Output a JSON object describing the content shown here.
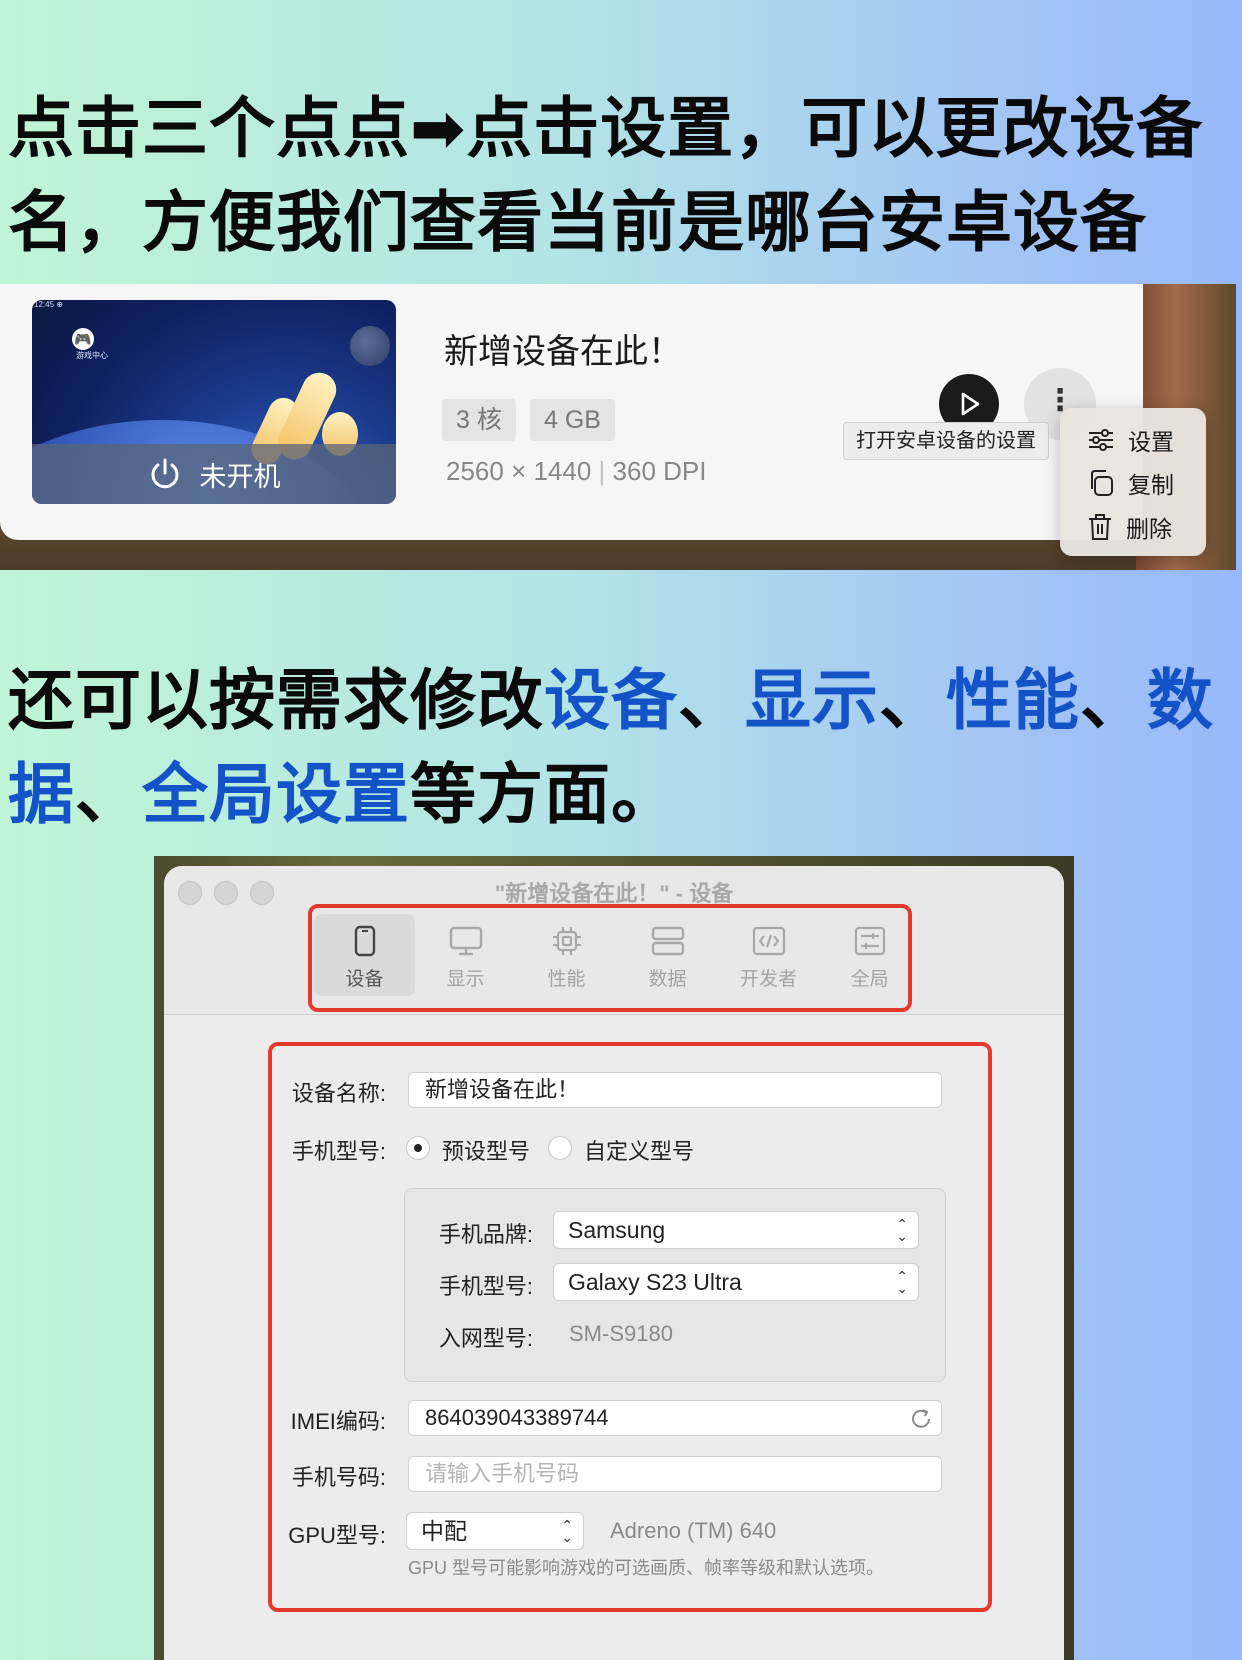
{
  "headings": {
    "h1": "点击三个点点➡点击设置，可以更改设备名，方便我们查看当前是哪台安卓设备",
    "h2_prefix": "还可以按需求修改",
    "h2_sep": "、",
    "h2_items": [
      "设备",
      "显示",
      "性能",
      "数据",
      "全局设置"
    ],
    "h2_suffix": "等方面。"
  },
  "device_card": {
    "name": "新增设备在此！",
    "status": "未开机",
    "cores": "3 核",
    "memory": "4 GB",
    "resolution": "2560 × 1440",
    "spec_divider": "|",
    "dpi": "360 DPI",
    "tooltip": "打开安卓设备的设置",
    "more_glyph": "⋮",
    "thumb_status": "12:45 ⊕",
    "thumb_app_label": "游戏中心",
    "menu": [
      "设置",
      "复制",
      "删除"
    ]
  },
  "settings_window": {
    "title": "\"新增设备在此！\" - 设备",
    "tabs": [
      {
        "label": "设备",
        "icon": "phone-icon"
      },
      {
        "label": "显示",
        "icon": "monitor-icon"
      },
      {
        "label": "性能",
        "icon": "chip-icon"
      },
      {
        "label": "数据",
        "icon": "storage-icon"
      },
      {
        "label": "开发者",
        "icon": "code-icon"
      },
      {
        "label": "全局",
        "icon": "sliders-icon"
      }
    ],
    "active_tab": "设备",
    "form": {
      "device_name_label": "设备名称:",
      "device_name_value": "新增设备在此！",
      "phone_model_label": "手机型号:",
      "radio_preset": "预设型号",
      "radio_custom": "自定义型号",
      "brand_label": "手机品牌:",
      "brand_value": "Samsung",
      "model_label": "手机型号:",
      "model_value": "Galaxy S23 Ultra",
      "network_model_label": "入网型号:",
      "network_model_value": "SM-S9180",
      "imei_label": "IMEI编码:",
      "imei_value": "864039043389744",
      "phone_number_label": "手机号码:",
      "phone_number_placeholder": "请输入手机号码",
      "gpu_label": "GPU型号:",
      "gpu_value": "中配",
      "gpu_detail": "Adreno (TM) 640",
      "gpu_hint": "GPU 型号可能影响游戏的可选画质、帧率等级和默认选项。"
    }
  }
}
